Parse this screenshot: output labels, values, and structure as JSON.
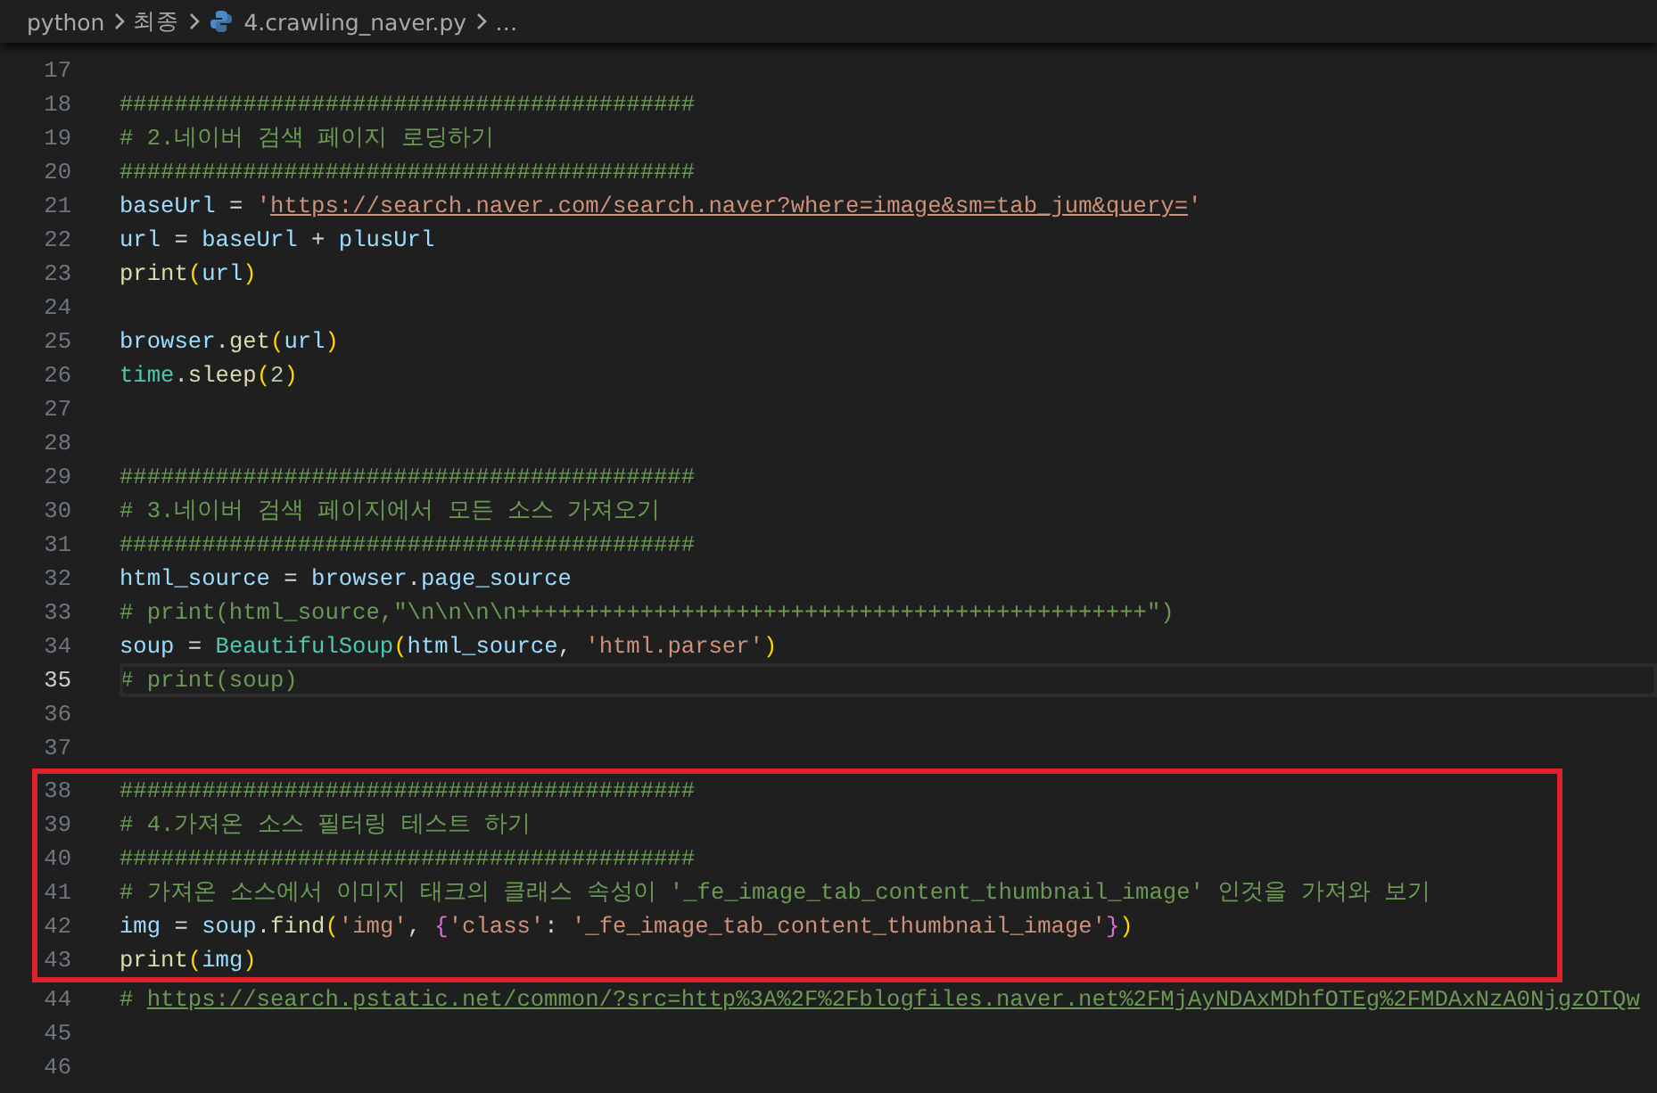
{
  "breadcrumbs": [
    {
      "label": "python",
      "kind": "folder"
    },
    {
      "label": "최종",
      "kind": "folder"
    },
    {
      "label": "4.crawling_naver.py",
      "kind": "file"
    },
    {
      "label": "…",
      "kind": "more"
    }
  ],
  "editor": {
    "lines": [
      {
        "number": "17",
        "current": false,
        "framed": false
      },
      {
        "number": "18",
        "current": false,
        "framed": false,
        "tokens": [
          {
            "t": "##########################################",
            "kind": "comment"
          }
        ]
      },
      {
        "number": "19",
        "current": false,
        "framed": false,
        "tokens": [
          {
            "t": "# 2.네이버 검색 페이지 로딩하기",
            "kind": "comment"
          }
        ]
      },
      {
        "number": "20",
        "current": false,
        "framed": false,
        "tokens": [
          {
            "t": "##########################################",
            "kind": "comment"
          }
        ]
      },
      {
        "number": "21",
        "current": false,
        "framed": false,
        "tokens": [
          {
            "t": "baseUrl",
            "kind": "var"
          },
          {
            "t": " = ",
            "kind": "op"
          },
          {
            "t": "'",
            "kind": "str"
          },
          {
            "t": "https://search.naver.com/search.naver?where=image&sm=tab_jum&query=",
            "kind": "link"
          },
          {
            "t": "'",
            "kind": "str"
          }
        ]
      },
      {
        "number": "22",
        "current": false,
        "framed": false,
        "tokens": [
          {
            "t": "url",
            "kind": "var"
          },
          {
            "t": " = ",
            "kind": "op"
          },
          {
            "t": "baseUrl",
            "kind": "var"
          },
          {
            "t": " + ",
            "kind": "op"
          },
          {
            "t": "plusUrl",
            "kind": "var"
          }
        ]
      },
      {
        "number": "23",
        "current": false,
        "framed": false,
        "tokens": [
          {
            "t": "print",
            "kind": "func"
          },
          {
            "t": "(",
            "kind": "paren"
          },
          {
            "t": "url",
            "kind": "var"
          },
          {
            "t": ")",
            "kind": "paren"
          }
        ]
      },
      {
        "number": "24",
        "current": false,
        "framed": false
      },
      {
        "number": "25",
        "current": false,
        "framed": false,
        "tokens": [
          {
            "t": "browser",
            "kind": "var"
          },
          {
            "t": ".",
            "kind": "op"
          },
          {
            "t": "get",
            "kind": "func"
          },
          {
            "t": "(",
            "kind": "paren"
          },
          {
            "t": "url",
            "kind": "var"
          },
          {
            "t": ")",
            "kind": "paren"
          }
        ]
      },
      {
        "number": "26",
        "current": false,
        "framed": false,
        "tokens": [
          {
            "t": "time",
            "kind": "cls"
          },
          {
            "t": ".",
            "kind": "op"
          },
          {
            "t": "sleep",
            "kind": "func"
          },
          {
            "t": "(",
            "kind": "paren"
          },
          {
            "t": "2",
            "kind": "num"
          },
          {
            "t": ")",
            "kind": "paren"
          }
        ]
      },
      {
        "number": "27",
        "current": false,
        "framed": false
      },
      {
        "number": "28",
        "current": false,
        "framed": false
      },
      {
        "number": "29",
        "current": false,
        "framed": false,
        "tokens": [
          {
            "t": "##########################################",
            "kind": "comment"
          }
        ]
      },
      {
        "number": "30",
        "current": false,
        "framed": false,
        "tokens": [
          {
            "t": "# 3.네이버 검색 페이지에서 모든 소스 가져오기",
            "kind": "comment"
          }
        ]
      },
      {
        "number": "31",
        "current": false,
        "framed": false,
        "tokens": [
          {
            "t": "##########################################",
            "kind": "comment"
          }
        ]
      },
      {
        "number": "32",
        "current": false,
        "framed": false,
        "tokens": [
          {
            "t": "html_source",
            "kind": "var"
          },
          {
            "t": " = ",
            "kind": "op"
          },
          {
            "t": "browser",
            "kind": "var"
          },
          {
            "t": ".",
            "kind": "op"
          },
          {
            "t": "page_source",
            "kind": "var"
          }
        ]
      },
      {
        "number": "33",
        "current": false,
        "framed": false,
        "tokens": [
          {
            "t": "# print(html_source,\"\\n\\n\\n\\n++++++++++++++++++++++++++++++++++++++++++++++\")",
            "kind": "comment"
          }
        ]
      },
      {
        "number": "34",
        "current": false,
        "framed": false,
        "tokens": [
          {
            "t": "soup",
            "kind": "var"
          },
          {
            "t": " = ",
            "kind": "op"
          },
          {
            "t": "BeautifulSoup",
            "kind": "cls"
          },
          {
            "t": "(",
            "kind": "paren"
          },
          {
            "t": "html_source",
            "kind": "var"
          },
          {
            "t": ", ",
            "kind": "op"
          },
          {
            "t": "'html.parser'",
            "kind": "str"
          },
          {
            "t": ")",
            "kind": "paren"
          }
        ]
      },
      {
        "number": "35",
        "current": true,
        "framed": false,
        "tokens": [
          {
            "t": "# print(soup)",
            "kind": "comment"
          }
        ]
      },
      {
        "number": "36",
        "current": false,
        "framed": false
      },
      {
        "number": "37",
        "current": false,
        "framed": false
      },
      {
        "number": "38",
        "current": false,
        "framed": true,
        "tokens": [
          {
            "t": "##########################################",
            "kind": "comment"
          }
        ]
      },
      {
        "number": "39",
        "current": false,
        "framed": true,
        "tokens": [
          {
            "t": "# 4.가져온 소스 필터링 테스트 하기",
            "kind": "comment"
          }
        ]
      },
      {
        "number": "40",
        "current": false,
        "framed": true,
        "tokens": [
          {
            "t": "##########################################",
            "kind": "comment"
          }
        ]
      },
      {
        "number": "41",
        "current": false,
        "framed": true,
        "tokens": [
          {
            "t": "# 가져온 소스에서 이미지 태크의 클래스 속성이 '_fe_image_tab_content_thumbnail_image' 인것을 가져와 보기",
            "kind": "comment"
          }
        ]
      },
      {
        "number": "42",
        "current": false,
        "framed": true,
        "tokens": [
          {
            "t": "img",
            "kind": "var"
          },
          {
            "t": " = ",
            "kind": "op"
          },
          {
            "t": "soup",
            "kind": "var"
          },
          {
            "t": ".",
            "kind": "op"
          },
          {
            "t": "find",
            "kind": "func"
          },
          {
            "t": "(",
            "kind": "paren"
          },
          {
            "t": "'img'",
            "kind": "str"
          },
          {
            "t": ", ",
            "kind": "op"
          },
          {
            "t": "{",
            "kind": "brace"
          },
          {
            "t": "'class'",
            "kind": "str"
          },
          {
            "t": ": ",
            "kind": "op"
          },
          {
            "t": "'_fe_image_tab_content_thumbnail_image'",
            "kind": "str"
          },
          {
            "t": "}",
            "kind": "brace"
          },
          {
            "t": ")",
            "kind": "paren"
          }
        ]
      },
      {
        "number": "43",
        "current": false,
        "framed": true,
        "tokens": [
          {
            "t": "print",
            "kind": "func"
          },
          {
            "t": "(",
            "kind": "paren"
          },
          {
            "t": "img",
            "kind": "var"
          },
          {
            "t": ")",
            "kind": "paren"
          }
        ]
      },
      {
        "number": "44",
        "current": false,
        "framed": false,
        "tokens": [
          {
            "t": "# ",
            "kind": "comment"
          },
          {
            "t": "https://search.pstatic.net/common/?src=http%3A%2F%2Fblogfiles.naver.net%2FMjAyNDAxMDhfOTEg%2FMDAxNzA0NjgzOTQw",
            "kind": "comment_link"
          }
        ]
      },
      {
        "number": "45",
        "current": false,
        "framed": false
      },
      {
        "number": "46",
        "current": false,
        "framed": false
      }
    ]
  }
}
